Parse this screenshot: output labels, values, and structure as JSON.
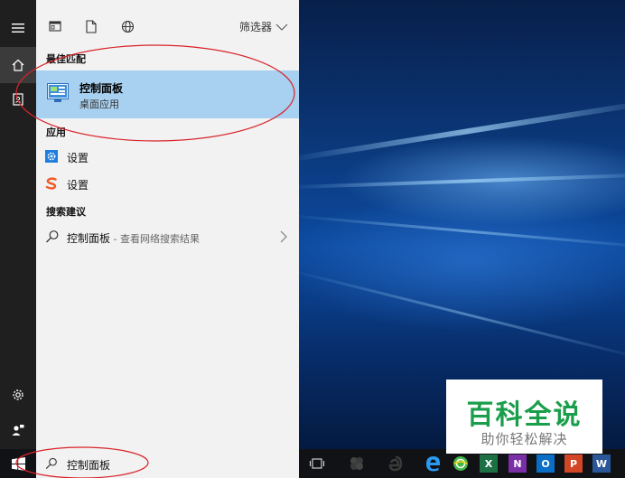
{
  "toolbar": {
    "filter_label": "筛选器"
  },
  "sections": {
    "best_match": "最佳匹配",
    "apps": "应用",
    "suggestions": "搜索建议"
  },
  "best_match": {
    "title": "控制面板",
    "subtitle": "桌面应用"
  },
  "apps": [
    {
      "label": "设置",
      "icon": "gear-blue-icon"
    },
    {
      "label": "设置",
      "icon": "sogou-s-icon"
    }
  ],
  "suggestion": {
    "query": "控制面板",
    "hint": " - 查看网络搜索结果"
  },
  "search_box": {
    "value": "控制面板"
  },
  "taskbar_icons": [
    "task-view-icon",
    "app-icon",
    "app-icon",
    "edge-icon",
    "360-browser-icon",
    "excel-icon",
    "onenote-icon",
    "outlook-icon",
    "powerpoint-icon",
    "word-icon"
  ],
  "taskbar_labels": {
    "excel": "X",
    "onenote": "N",
    "outlook": "O",
    "powerpoint": "P",
    "word": "W"
  },
  "watermark": {
    "title": "百科全说",
    "subtitle": "助你轻松解决"
  },
  "colors": {
    "accent": "#0078d7",
    "highlight": "#a8d0f0",
    "annotation": "#d9232a",
    "watermark_green": "#1a9e4b"
  }
}
